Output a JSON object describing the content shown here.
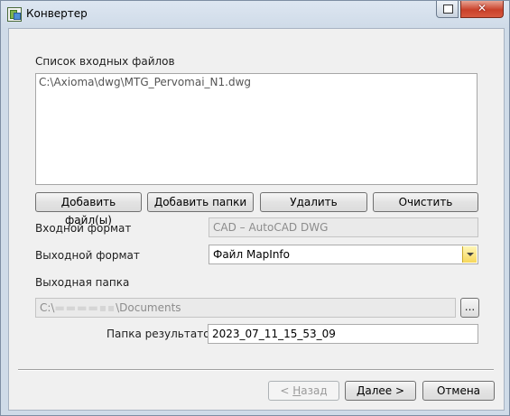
{
  "window": {
    "title": "Конвертер"
  },
  "input_files": {
    "label": "Список входных файлов",
    "items": [
      "C:\\Axioma\\dwg\\MTG_Pervomai_N1.dwg"
    ]
  },
  "file_buttons": {
    "add_files": "Добавить файл(ы)",
    "add_folders": "Добавить папки",
    "remove": "Удалить",
    "clear": "Очистить"
  },
  "input_format": {
    "label": "Входной формат",
    "value": "CAD – AutoCAD DWG"
  },
  "output_format": {
    "label": "Выходной формат",
    "value": "Файл MapInfo"
  },
  "output_folder": {
    "label": "Выходная папка",
    "value": "C:\\",
    "value_tail": "\\Documents",
    "browse_label": "..."
  },
  "results_folder": {
    "label": "Папка результатов",
    "value": "2023_07_11_15_53_09"
  },
  "nav_buttons": {
    "back_prefix": "< ",
    "back_key": "Н",
    "back_rest": "азад",
    "next_key": "Д",
    "next_rest": "алее >",
    "cancel": "Отмена"
  }
}
